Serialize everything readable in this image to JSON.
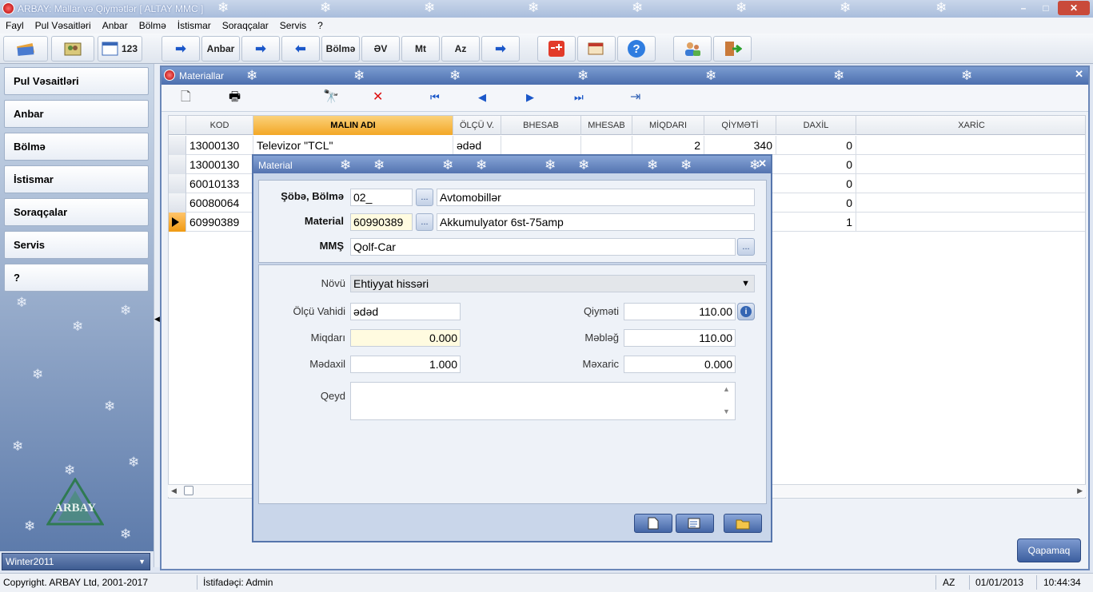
{
  "app": {
    "title": "ARBAY: Mallar və Qiymətlər [ ALTAY MMC ]"
  },
  "menu": [
    "Fayl",
    "Pul Vəsaitləri",
    "Anbar",
    "Bölmə",
    "İstismar",
    "Soraqçalar",
    "Servis",
    "?"
  ],
  "toolbar": {
    "counter_label": "123",
    "anbar": "Anbar",
    "bolme": "Bölmə",
    "ev": "ƏV",
    "mt": "Mt",
    "az": "Az"
  },
  "sidebar": {
    "items": [
      "Pul Vəsaitləri",
      "Anbar",
      "Bölmə",
      "İstismar",
      "Soraqçalar",
      "Servis",
      "?"
    ],
    "logo_text": "ARBAY",
    "season": "Winter2011"
  },
  "materials_window": {
    "title": "Materiallar",
    "columns": [
      "KOD",
      "MALIN ADI",
      "ÖLÇÜ V.",
      "BHESAB",
      "MHESAB",
      "MİQDARI",
      "QİYMƏTİ",
      "DAXİL",
      "XARİC"
    ],
    "rows": [
      {
        "kod": "13000130",
        "ad": "Televizor \"TCL\"",
        "olcu": "ədəd",
        "miqdar": "2",
        "qiymet": "340",
        "daxil": "0"
      },
      {
        "kod": "13000130",
        "daxil": "0"
      },
      {
        "kod": "60010133",
        "daxil": "0"
      },
      {
        "kod": "60080064",
        "daxil": "0"
      },
      {
        "kod": "60990389",
        "daxil": "1"
      }
    ],
    "close_button": "Qapamaq"
  },
  "dialog": {
    "title": "Material",
    "sobe_label": "Şöbə, Bölmə",
    "sobe_code": "02_",
    "sobe_name": "Avtomobillər",
    "material_label": "Material",
    "material_code": "60990389",
    "material_name": "Akkumulyator 6st-75amp",
    "mms_label": "MMŞ",
    "mms_value": "Qolf-Car",
    "dots": "...",
    "novu_label": "Növü",
    "novu_value": "Ehtiyyat hissəri",
    "olcu_label": "Ölçü Vahidi",
    "olcu_value": "ədəd",
    "qiymet_label": "Qiyməti",
    "qiymet_value": "110.00",
    "miqdar_label": "Miqdarı",
    "miqdar_value": "0.000",
    "mebleg_label": "Məbləğ",
    "mebleg_value": "110.00",
    "medaxil_label": "Mədaxil",
    "medaxil_value": "1.000",
    "mexaric_label": "Məxaric",
    "mexaric_value": "0.000",
    "qeyd_label": "Qeyd",
    "qeyd_value": ""
  },
  "status": {
    "copyright": "Copyright. ARBAY Ltd, 2001-2017",
    "user": "İstifadəçi: Admin",
    "lang": "AZ",
    "date": "01/01/2013",
    "time": "10:44:34"
  },
  "colors": {
    "title_blue": "#5373b0",
    "highlight_orange": "#f3a726",
    "yellow_field": "#fffbe0"
  }
}
